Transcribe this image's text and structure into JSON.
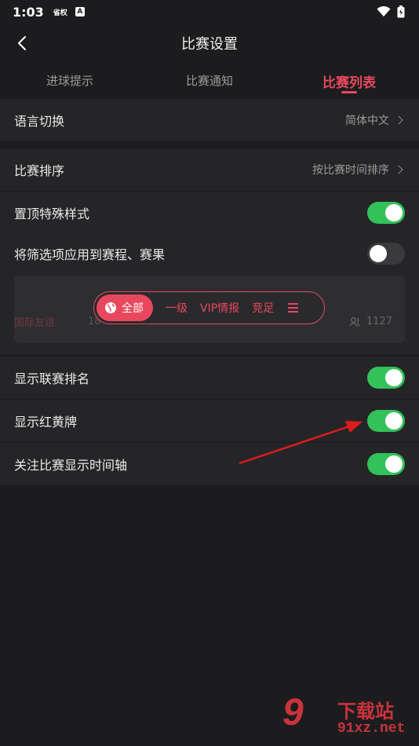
{
  "status": {
    "time": "1:03",
    "app_mini": "省权",
    "app_badge": "A"
  },
  "nav": {
    "title": "比赛设置"
  },
  "tabs": [
    {
      "label": "进球提示",
      "active": false
    },
    {
      "label": "比赛通知",
      "active": false
    },
    {
      "label": "比赛列表",
      "active": true
    }
  ],
  "settings": {
    "language": {
      "label": "语言切换",
      "value": "简体中文"
    },
    "sort": {
      "label": "比赛排序",
      "value": "按比赛时间排序"
    },
    "pin_style": {
      "label": "置顶特殊样式",
      "on": true
    },
    "apply_filter": {
      "label": "将筛选项应用到赛程、赛果",
      "on": false
    },
    "league_rank": {
      "label": "显示联赛排名",
      "on": true
    },
    "cards": {
      "label": "显示红黄牌",
      "on": true
    },
    "timeline": {
      "label": "关注比赛显示时间轴",
      "on": true
    }
  },
  "preview": {
    "league": "国际友谊",
    "num": "18",
    "count": "1127",
    "filters": {
      "all": "全部",
      "level1": "一级",
      "vip": "VIP情报",
      "jingzu": "竞足"
    }
  },
  "watermark": {
    "big": "9",
    "top": "下载站",
    "bottom": "91xz.net"
  },
  "colors": {
    "accent": "#e8485e",
    "toggle_on": "#33c15a",
    "background": "#1c1c1e",
    "row": "#252528"
  }
}
